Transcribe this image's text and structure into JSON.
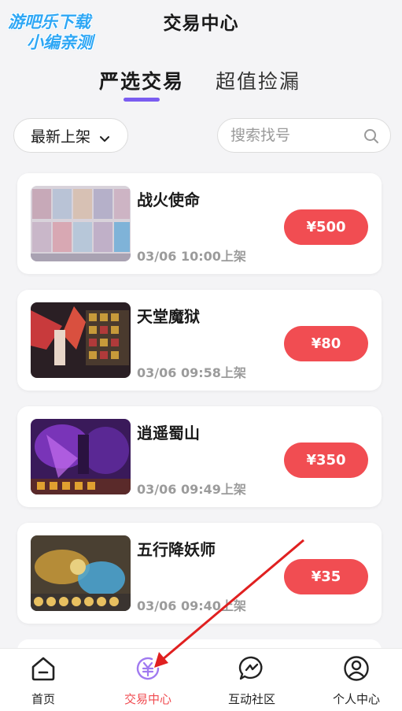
{
  "watermark": {
    "line1": "游吧乐下载",
    "line2": "小编亲测"
  },
  "header": {
    "title": "交易中心"
  },
  "tabs": [
    {
      "label": "严选交易",
      "active": true
    },
    {
      "label": "超值捡漏",
      "active": false
    }
  ],
  "filters": {
    "sort_label": "最新上架",
    "search_placeholder": "搜索找号"
  },
  "listings": [
    {
      "name": "战火使命",
      "time": "03/06 10:00上架",
      "price": "¥500"
    },
    {
      "name": "天堂魔狱",
      "time": "03/06 09:58上架",
      "price": "¥80"
    },
    {
      "name": "逍遥蜀山",
      "time": "03/06 09:49上架",
      "price": "¥350"
    },
    {
      "name": "五行降妖师",
      "time": "03/06 09:40上架",
      "price": "¥35"
    }
  ],
  "bottom_nav": [
    {
      "label": "首页",
      "icon": "home-icon"
    },
    {
      "label": "交易中心",
      "icon": "trade-yen-icon",
      "active": true
    },
    {
      "label": "互动社区",
      "icon": "chat-bubble-icon"
    },
    {
      "label": "个人中心",
      "icon": "user-icon"
    }
  ],
  "colors": {
    "accent_purple": "#7a5cf0",
    "price_red": "#f14d52",
    "nav_active": "#f04a4f",
    "watermark_blue": "#2ea7f5"
  }
}
